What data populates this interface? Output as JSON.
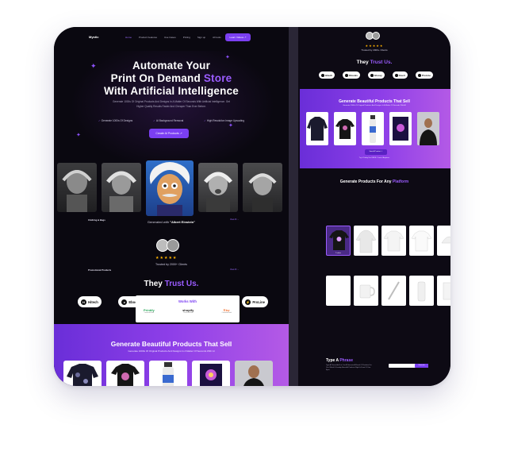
{
  "nav": {
    "logo": "Mystic",
    "links": [
      "Home",
      "Product Features",
      "Use Cases",
      "Pricing",
      "Sign up",
      "All tools"
    ],
    "button": "Learn Videos ↗"
  },
  "hero": {
    "title_line1": "Automate Your",
    "title_line2a": "Print On Demand ",
    "title_line2b": "Store",
    "title_line3": "With Artificial Intelligence",
    "subtitle": "Generate 1000s Of Original Products And Designs In A Matter Of Seconds With Artificial Intelligence. Get Higher Quality Results Faster And Cheaper Than Ever Before.",
    "features": [
      "Generate 1000s Of Designs",
      "AI Background Removal",
      "High Resolution Image Upscaling"
    ],
    "cta": "Create AI Products ↗"
  },
  "generated": {
    "label_prefix": "Generated with ",
    "label_value": "\"Albert Einstein\""
  },
  "rating": {
    "stars": "★★★★★",
    "trusted": "Trusted by 2000+ Clients"
  },
  "trust": {
    "title_prefix": "They ",
    "title_accent": "Trust Us.",
    "brands": [
      "Hitech",
      "Ebooks",
      "Glossy",
      "Invert",
      "ProLine"
    ]
  },
  "products_band": {
    "title": "Generate Beautiful Products That Sell",
    "subtitle": "Generate 1000s Of Original Products And Designs In A Matter Of Seconds With AI"
  },
  "right_panel": {
    "stars": "★★★★★",
    "trusted": "Trusted by 2000+ Clients",
    "trust_title_prefix": "They ",
    "trust_title_accent": "Trust Us.",
    "brands": [
      "Hitech",
      "Ebooks",
      "Glossy",
      "Invert",
      "ProLine"
    ],
    "band_title": "Generate Beautiful Products That Sell",
    "band_sub": "Generate 1000s Of Original Products And Designs In A Matter Of Seconds With AI",
    "band_button": "Start A Product ↗",
    "band_note": "Try It Today For FREE. Cancel Anytime.",
    "platform_title_prefix": "Generate Products For Any ",
    "platform_title_accent": "Platform",
    "category1": "Clothing & Bags",
    "category2": "Promotional Products",
    "view_all": "View All →",
    "tile_label": "T-shirts",
    "works_title": "Works With",
    "works_logos": [
      {
        "name": "Printify",
        "sub": "Connected with"
      },
      {
        "name": "shopify",
        "sub": "Connected with"
      },
      {
        "name": "Etsy",
        "sub": "Connected with"
      }
    ],
    "type_title_prefix": "Type A ",
    "type_title_accent": "Phrase",
    "type_sub": "Type A Phrase And Let Our AI Generate A Brand Of Products For You. Watch It Develop Beautiful Products Right In Front Of Your Eyes.",
    "type_button": "Generate"
  },
  "colors": {
    "accent": "#9b5cff",
    "button": "#7b3ff2",
    "background": "#0a0810",
    "star": "#ffb300"
  }
}
